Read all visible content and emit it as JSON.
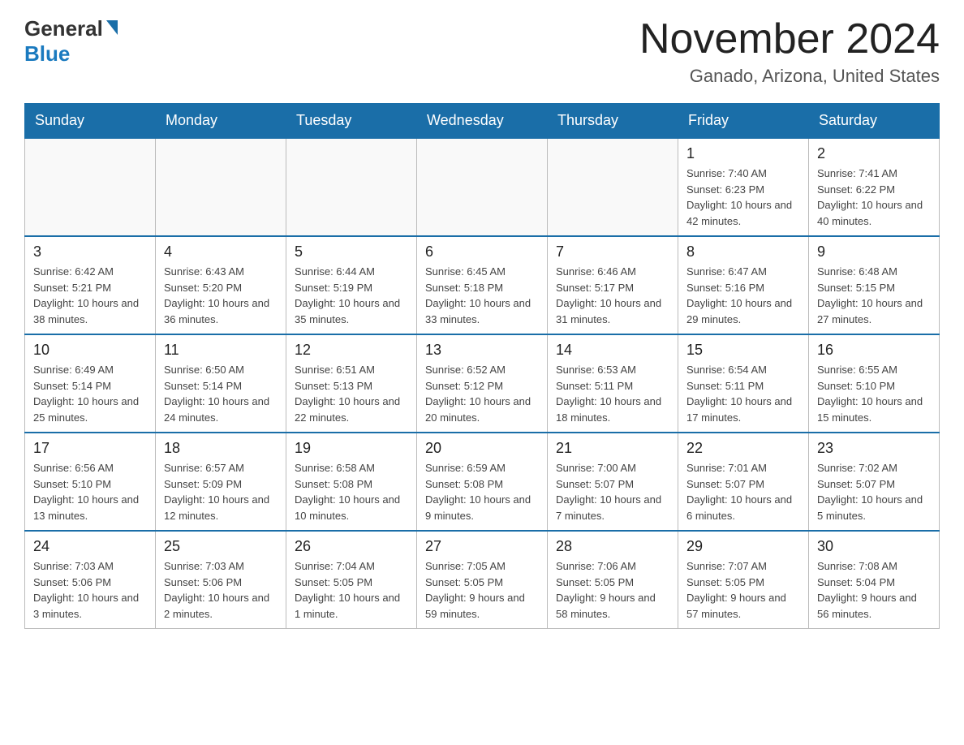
{
  "logo": {
    "general": "General",
    "blue": "Blue"
  },
  "header": {
    "title": "November 2024",
    "subtitle": "Ganado, Arizona, United States"
  },
  "weekdays": [
    "Sunday",
    "Monday",
    "Tuesday",
    "Wednesday",
    "Thursday",
    "Friday",
    "Saturday"
  ],
  "weeks": [
    [
      {
        "day": "",
        "info": ""
      },
      {
        "day": "",
        "info": ""
      },
      {
        "day": "",
        "info": ""
      },
      {
        "day": "",
        "info": ""
      },
      {
        "day": "",
        "info": ""
      },
      {
        "day": "1",
        "info": "Sunrise: 7:40 AM\nSunset: 6:23 PM\nDaylight: 10 hours and 42 minutes."
      },
      {
        "day": "2",
        "info": "Sunrise: 7:41 AM\nSunset: 6:22 PM\nDaylight: 10 hours and 40 minutes."
      }
    ],
    [
      {
        "day": "3",
        "info": "Sunrise: 6:42 AM\nSunset: 5:21 PM\nDaylight: 10 hours and 38 minutes."
      },
      {
        "day": "4",
        "info": "Sunrise: 6:43 AM\nSunset: 5:20 PM\nDaylight: 10 hours and 36 minutes."
      },
      {
        "day": "5",
        "info": "Sunrise: 6:44 AM\nSunset: 5:19 PM\nDaylight: 10 hours and 35 minutes."
      },
      {
        "day": "6",
        "info": "Sunrise: 6:45 AM\nSunset: 5:18 PM\nDaylight: 10 hours and 33 minutes."
      },
      {
        "day": "7",
        "info": "Sunrise: 6:46 AM\nSunset: 5:17 PM\nDaylight: 10 hours and 31 minutes."
      },
      {
        "day": "8",
        "info": "Sunrise: 6:47 AM\nSunset: 5:16 PM\nDaylight: 10 hours and 29 minutes."
      },
      {
        "day": "9",
        "info": "Sunrise: 6:48 AM\nSunset: 5:15 PM\nDaylight: 10 hours and 27 minutes."
      }
    ],
    [
      {
        "day": "10",
        "info": "Sunrise: 6:49 AM\nSunset: 5:14 PM\nDaylight: 10 hours and 25 minutes."
      },
      {
        "day": "11",
        "info": "Sunrise: 6:50 AM\nSunset: 5:14 PM\nDaylight: 10 hours and 24 minutes."
      },
      {
        "day": "12",
        "info": "Sunrise: 6:51 AM\nSunset: 5:13 PM\nDaylight: 10 hours and 22 minutes."
      },
      {
        "day": "13",
        "info": "Sunrise: 6:52 AM\nSunset: 5:12 PM\nDaylight: 10 hours and 20 minutes."
      },
      {
        "day": "14",
        "info": "Sunrise: 6:53 AM\nSunset: 5:11 PM\nDaylight: 10 hours and 18 minutes."
      },
      {
        "day": "15",
        "info": "Sunrise: 6:54 AM\nSunset: 5:11 PM\nDaylight: 10 hours and 17 minutes."
      },
      {
        "day": "16",
        "info": "Sunrise: 6:55 AM\nSunset: 5:10 PM\nDaylight: 10 hours and 15 minutes."
      }
    ],
    [
      {
        "day": "17",
        "info": "Sunrise: 6:56 AM\nSunset: 5:10 PM\nDaylight: 10 hours and 13 minutes."
      },
      {
        "day": "18",
        "info": "Sunrise: 6:57 AM\nSunset: 5:09 PM\nDaylight: 10 hours and 12 minutes."
      },
      {
        "day": "19",
        "info": "Sunrise: 6:58 AM\nSunset: 5:08 PM\nDaylight: 10 hours and 10 minutes."
      },
      {
        "day": "20",
        "info": "Sunrise: 6:59 AM\nSunset: 5:08 PM\nDaylight: 10 hours and 9 minutes."
      },
      {
        "day": "21",
        "info": "Sunrise: 7:00 AM\nSunset: 5:07 PM\nDaylight: 10 hours and 7 minutes."
      },
      {
        "day": "22",
        "info": "Sunrise: 7:01 AM\nSunset: 5:07 PM\nDaylight: 10 hours and 6 minutes."
      },
      {
        "day": "23",
        "info": "Sunrise: 7:02 AM\nSunset: 5:07 PM\nDaylight: 10 hours and 5 minutes."
      }
    ],
    [
      {
        "day": "24",
        "info": "Sunrise: 7:03 AM\nSunset: 5:06 PM\nDaylight: 10 hours and 3 minutes."
      },
      {
        "day": "25",
        "info": "Sunrise: 7:03 AM\nSunset: 5:06 PM\nDaylight: 10 hours and 2 minutes."
      },
      {
        "day": "26",
        "info": "Sunrise: 7:04 AM\nSunset: 5:05 PM\nDaylight: 10 hours and 1 minute."
      },
      {
        "day": "27",
        "info": "Sunrise: 7:05 AM\nSunset: 5:05 PM\nDaylight: 9 hours and 59 minutes."
      },
      {
        "day": "28",
        "info": "Sunrise: 7:06 AM\nSunset: 5:05 PM\nDaylight: 9 hours and 58 minutes."
      },
      {
        "day": "29",
        "info": "Sunrise: 7:07 AM\nSunset: 5:05 PM\nDaylight: 9 hours and 57 minutes."
      },
      {
        "day": "30",
        "info": "Sunrise: 7:08 AM\nSunset: 5:04 PM\nDaylight: 9 hours and 56 minutes."
      }
    ]
  ]
}
